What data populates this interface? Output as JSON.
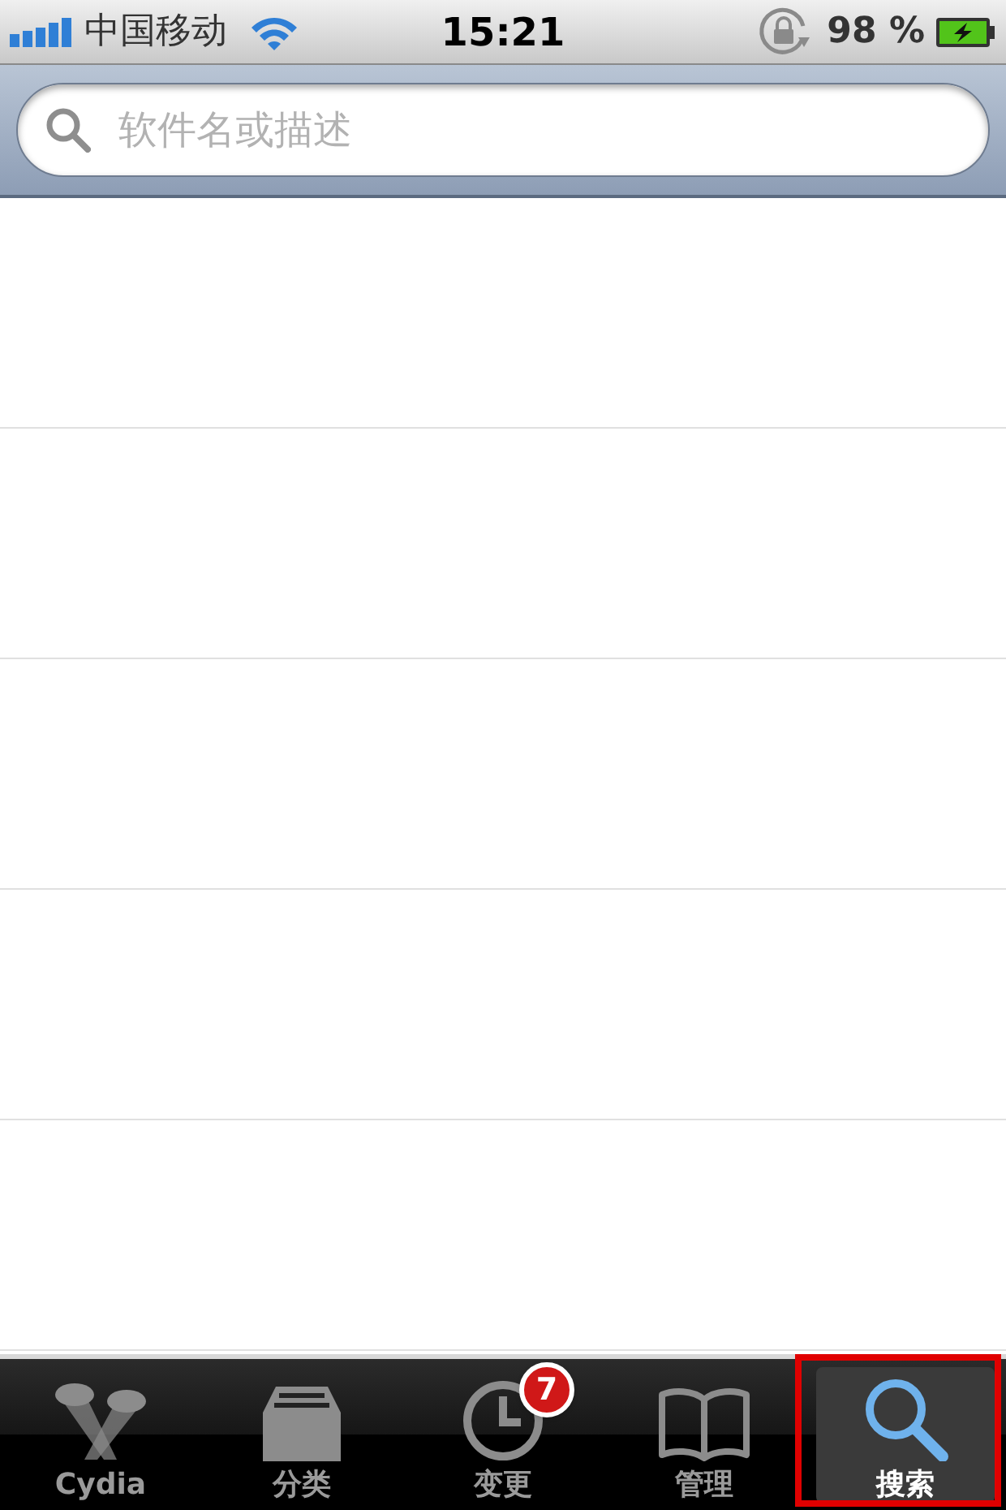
{
  "status_bar": {
    "carrier": "中国移动",
    "time": "15:21",
    "battery": "98 %"
  },
  "search": {
    "placeholder": "软件名或描述"
  },
  "tabs": [
    {
      "kind": "cydia",
      "label": "Cydia",
      "selected": false,
      "highlighted": false
    },
    {
      "kind": "sections",
      "label": "分类",
      "selected": false,
      "highlighted": false
    },
    {
      "kind": "changes",
      "label": "变更",
      "selected": false,
      "highlighted": false,
      "badge": "7"
    },
    {
      "kind": "manage",
      "label": "管理",
      "selected": false,
      "highlighted": false
    },
    {
      "kind": "search",
      "label": "搜索",
      "selected": true,
      "highlighted": true
    }
  ]
}
